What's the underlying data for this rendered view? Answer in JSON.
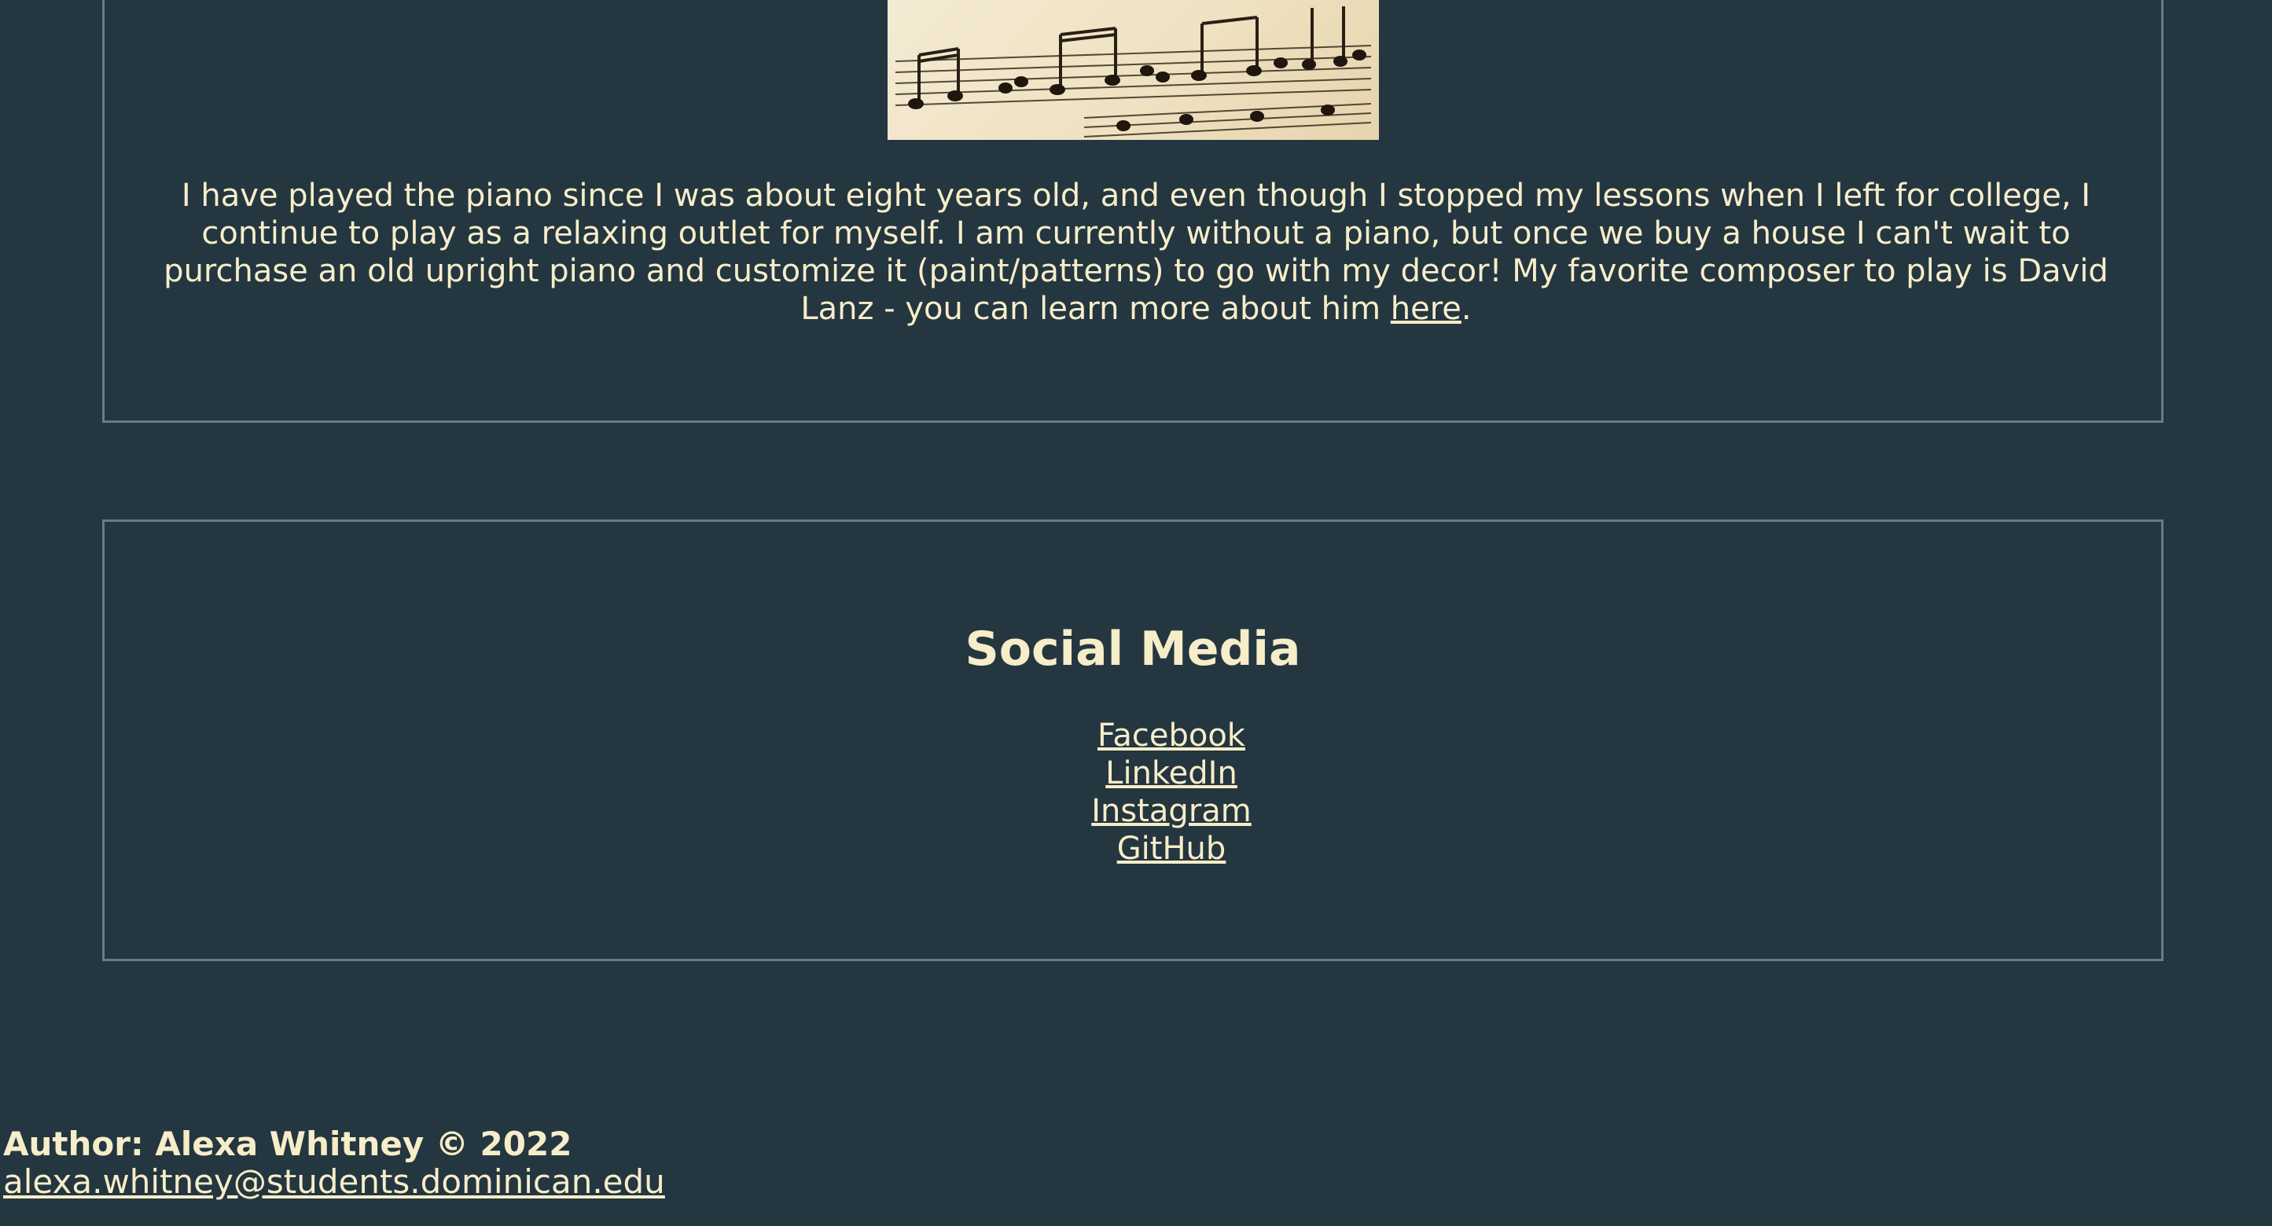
{
  "hobby": {
    "image_alt": "Sheet music",
    "paragraph_text": "I have played the piano since I was about eight years old, and even though I stopped my lessons when I left for college, I continue to play as a relaxing outlet for myself. I am currently without a piano, but once we buy a house I can't wait to purchase an old upright piano and customize it (paint/patterns) to go with my decor! My favorite composer to play is David Lanz - you can learn more about him ",
    "link_label": "here",
    "paragraph_end": "."
  },
  "social": {
    "title": "Social Media",
    "links": [
      {
        "label": "Facebook"
      },
      {
        "label": "LinkedIn"
      },
      {
        "label": "Instagram"
      },
      {
        "label": "GitHub"
      }
    ]
  },
  "footer": {
    "author": "Author: Alexa Whitney © 2022",
    "email": "alexa.whitney@students.dominican.edu"
  },
  "colors": {
    "background": "#243640",
    "text": "#f6edc9",
    "border": "#6b7b84"
  }
}
